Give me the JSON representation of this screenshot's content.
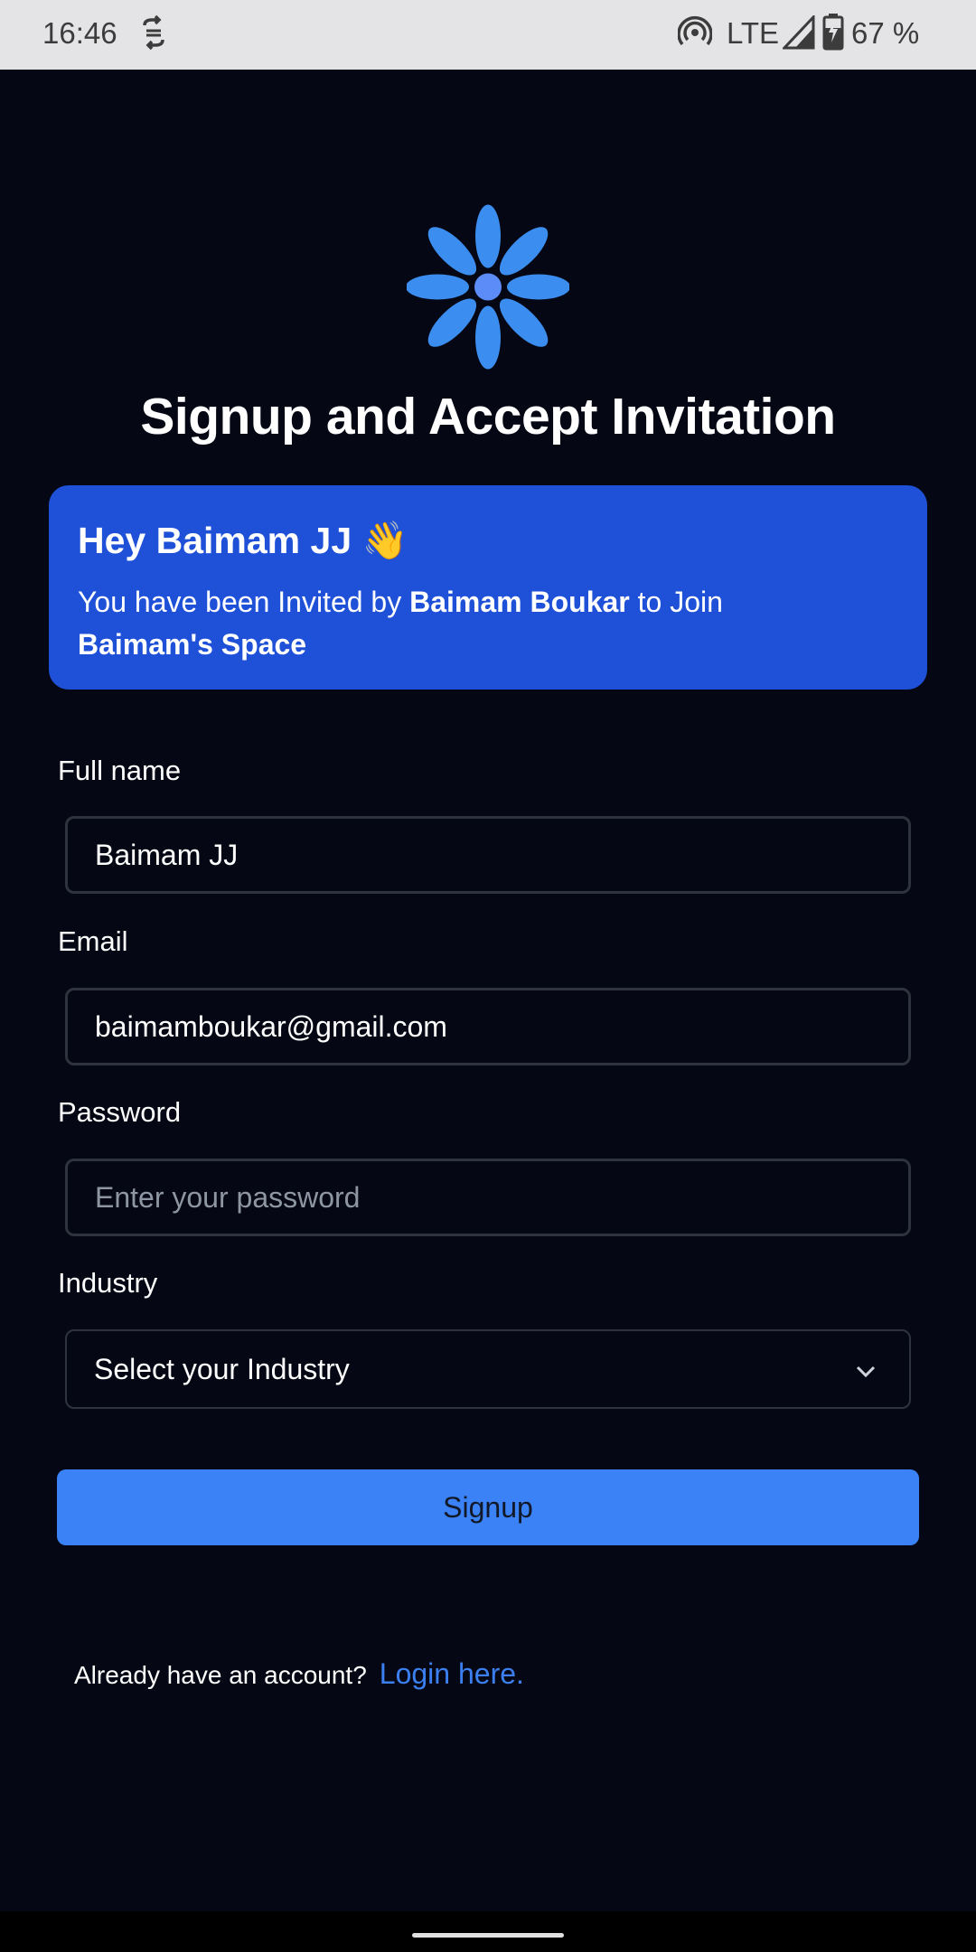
{
  "status_bar": {
    "time": "16:46",
    "network": "LTE",
    "battery": "67 %"
  },
  "header": {
    "title": "Signup and Accept Invitation"
  },
  "invite": {
    "greeting": "Hey Baimam JJ 👋",
    "text_before": "You have been Invited by ",
    "inviter": "Baimam Boukar",
    "text_middle": " to Join",
    "space": "Baimam's Space"
  },
  "form": {
    "full_name": {
      "label": "Full name",
      "value": "Baimam JJ"
    },
    "email": {
      "label": "Email",
      "value": "baimamboukar@gmail.com"
    },
    "password": {
      "label": "Password",
      "placeholder": "Enter your password"
    },
    "industry": {
      "label": "Industry",
      "selected": "Select your Industry"
    }
  },
  "signup_button": "Signup",
  "login": {
    "prompt": "Already have an account?",
    "link": "Login here."
  },
  "colors": {
    "background": "#050814",
    "card": "#1e50d8",
    "accent": "#3b82f6",
    "logo": "#3b8ef0"
  },
  "icons": [
    "sync-icon",
    "hotspot-icon",
    "signal-icon",
    "battery-icon",
    "logo-flower-icon",
    "chevron-down-icon"
  ]
}
